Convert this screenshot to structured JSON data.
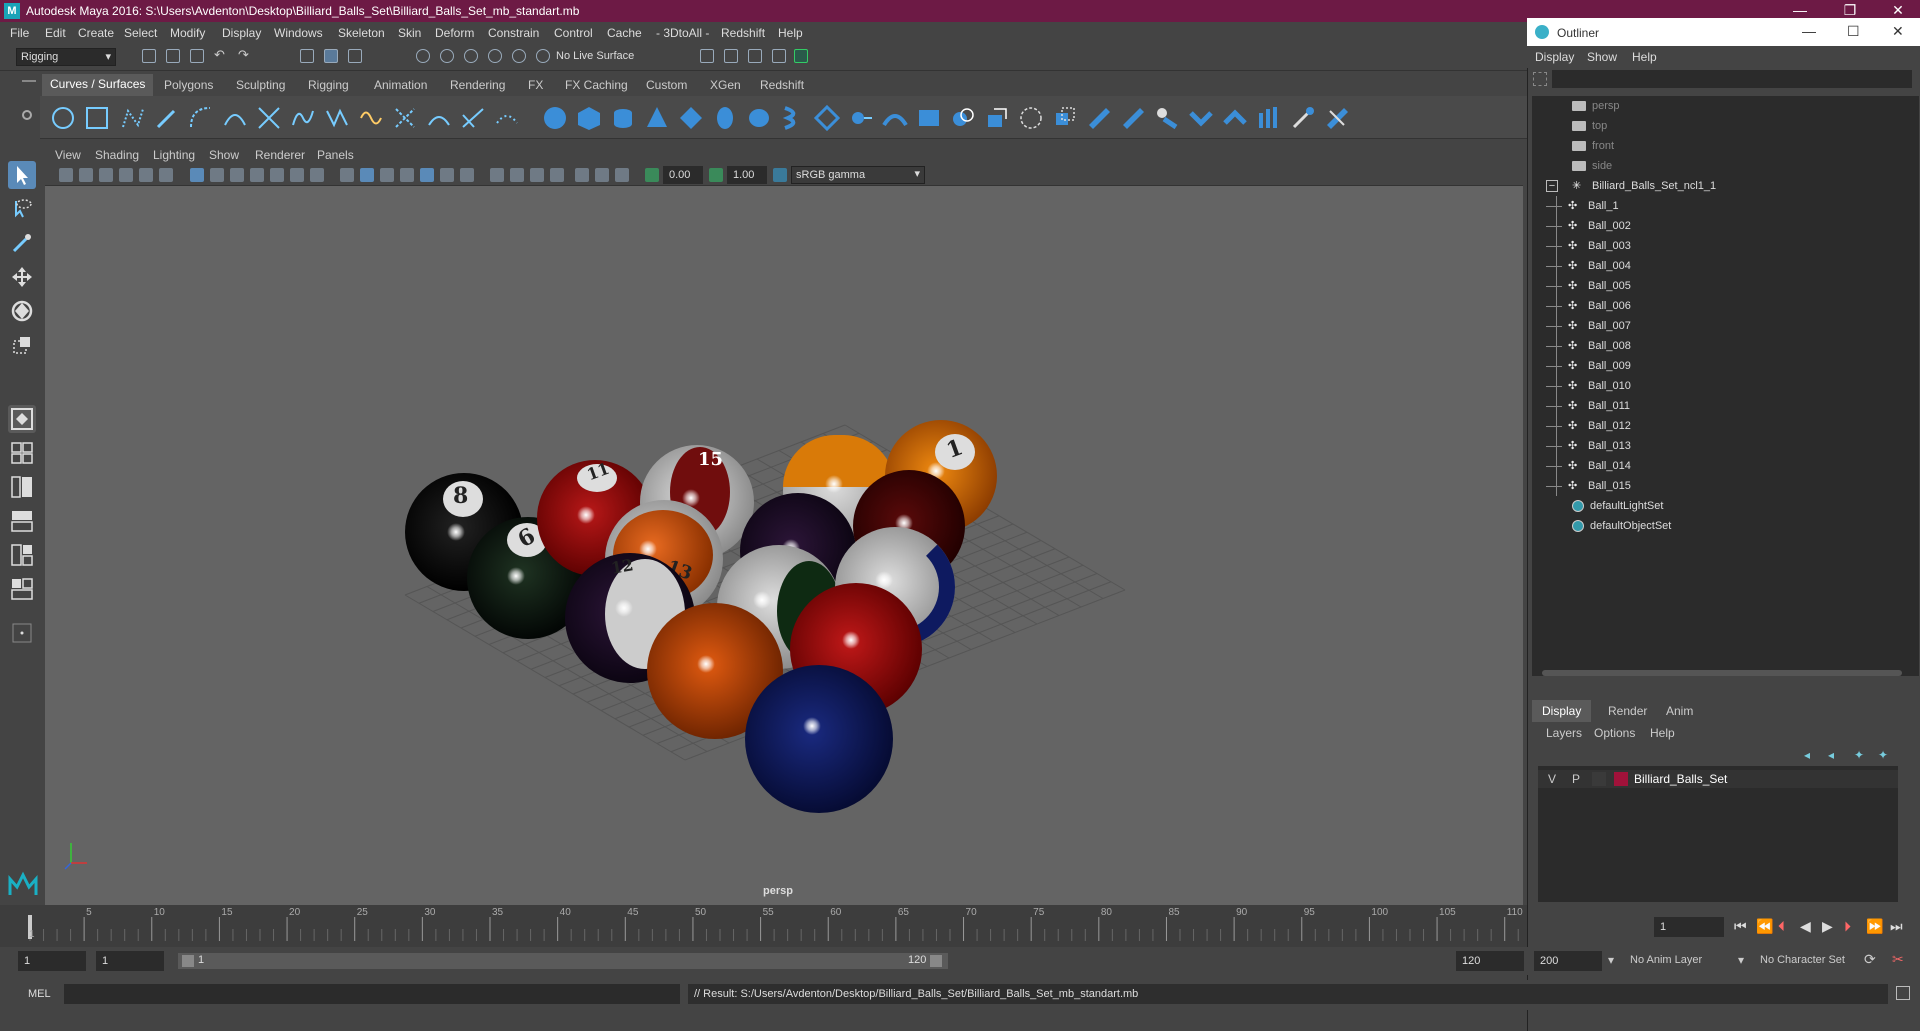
{
  "window": {
    "title": "Autodesk Maya 2016: S:\\Users\\Avdenton\\Desktop\\Billiard_Balls_Set\\Billiard_Balls_Set_mb_standart.mb",
    "logo": "M"
  },
  "menubar": [
    "File",
    "Edit",
    "Create",
    "Select",
    "Modify",
    "Display",
    "Windows",
    "Skeleton",
    "Skin",
    "Deform",
    "Constrain",
    "Control",
    "Cache",
    "- 3DtoAll -",
    "Redshift",
    "Help"
  ],
  "status": {
    "mode": "Rigging",
    "live_surface": "No Live Surface"
  },
  "shelf_tabs": [
    "Curves / Surfaces",
    "Polygons",
    "Sculpting",
    "Rigging",
    "Animation",
    "Rendering",
    "FX",
    "FX Caching",
    "Custom",
    "XGen",
    "Redshift"
  ],
  "viewport": {
    "menus": [
      "View",
      "Shading",
      "Lighting",
      "Show",
      "Renderer",
      "Panels"
    ],
    "exposure": "0.00",
    "gamma": "1.00",
    "color_space": "sRGB gamma",
    "camera_label": "persp",
    "ball_numbers": [
      "8",
      "6",
      "11",
      "15",
      "1",
      "13",
      "12"
    ]
  },
  "outliner": {
    "title": "Outliner",
    "menus": [
      "Display",
      "Show",
      "Help"
    ],
    "cameras": [
      "persp",
      "top",
      "front",
      "side"
    ],
    "group": "Billiard_Balls_Set_ncl1_1",
    "balls": [
      "Ball_1",
      "Ball_002",
      "Ball_003",
      "Ball_004",
      "Ball_005",
      "Ball_006",
      "Ball_007",
      "Ball_008",
      "Ball_009",
      "Ball_010",
      "Ball_011",
      "Ball_012",
      "Ball_013",
      "Ball_014",
      "Ball_015"
    ],
    "sets": [
      "defaultLightSet",
      "defaultObjectSet"
    ],
    "win_minimize": "—",
    "win_maximize": "☐",
    "win_close": "✕"
  },
  "layers": {
    "tabs": [
      "Display",
      "Render",
      "Anim"
    ],
    "menus": [
      "Layers",
      "Options",
      "Help"
    ],
    "row": {
      "v": "V",
      "p": "P",
      "name": "Billiard_Balls_Set",
      "color": "#a0123a"
    }
  },
  "timeline": {
    "ticks": [
      "5",
      "10",
      "15",
      "20",
      "25",
      "30",
      "35",
      "40",
      "45",
      "50",
      "55",
      "60",
      "65",
      "70",
      "75",
      "80",
      "85",
      "90",
      "95",
      "100",
      "105",
      "110",
      "115",
      "120"
    ],
    "first_tick": "1",
    "current_frame": "1"
  },
  "range": {
    "start": "1",
    "start2": "1",
    "slider_start": "1",
    "slider_end": "120",
    "end": "120",
    "max": "200",
    "anim_layer": "No Anim Layer",
    "char_set": "No Character Set"
  },
  "cmd": {
    "lang": "MEL",
    "result": "// Result: S:/Users/Avdenton/Desktop/Billiard_Balls_Set/Billiard_Balls_Set_mb_standart.mb"
  }
}
